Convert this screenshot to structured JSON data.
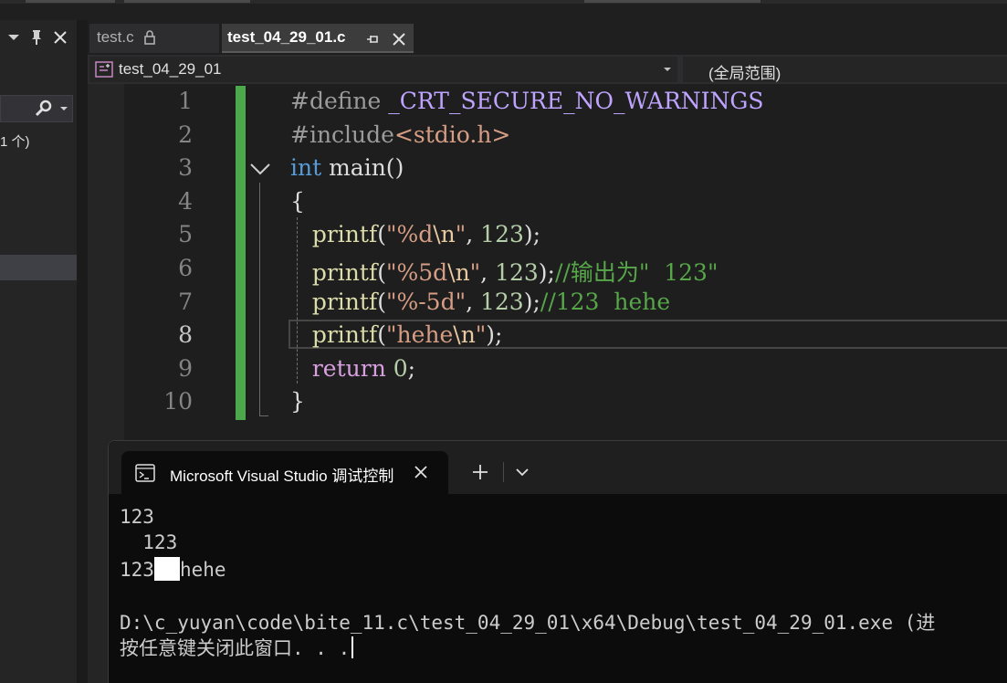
{
  "left_panel": {
    "search_icon": "search-icon",
    "count_text": "1 个)"
  },
  "tabs": [
    {
      "label": "test.c",
      "locked": true,
      "active": false
    },
    {
      "label": "test_04_29_01.c",
      "active": true
    }
  ],
  "nav": {
    "project": "test_04_29_01",
    "scope": "(全局范围)"
  },
  "editor": {
    "current_line": 8,
    "line_numbers": [
      "1",
      "2",
      "3",
      "4",
      "5",
      "6",
      "7",
      "8",
      "9",
      "10"
    ],
    "lines": [
      {
        "parts": [
          {
            "t": "#define ",
            "c": "pp"
          },
          {
            "t": "_CRT_SECURE_NO_WARNINGS",
            "c": "mac"
          }
        ]
      },
      {
        "parts": [
          {
            "t": "#include",
            "c": "pp"
          },
          {
            "t": "<stdio.h>",
            "c": "str"
          }
        ]
      },
      {
        "parts": [
          {
            "t": "int",
            "c": "kw"
          },
          {
            "t": " main()",
            "c": "plain"
          }
        ]
      },
      {
        "parts": [
          {
            "t": "{",
            "c": "plain"
          }
        ]
      },
      {
        "parts": [
          {
            "t": "   "
          },
          {
            "t": "printf",
            "c": "fn"
          },
          {
            "t": "(",
            "c": "plain"
          },
          {
            "t": "\"%d",
            "c": "str"
          },
          {
            "t": "\\n",
            "c": "esc"
          },
          {
            "t": "\"",
            "c": "str"
          },
          {
            "t": ", ",
            "c": "plain"
          },
          {
            "t": "123",
            "c": "num"
          },
          {
            "t": ");",
            "c": "plain"
          }
        ]
      },
      {
        "parts": [
          {
            "t": "   "
          },
          {
            "t": "printf",
            "c": "fn"
          },
          {
            "t": "(",
            "c": "plain"
          },
          {
            "t": "\"%5d",
            "c": "str"
          },
          {
            "t": "\\n",
            "c": "esc"
          },
          {
            "t": "\"",
            "c": "str"
          },
          {
            "t": ", ",
            "c": "plain"
          },
          {
            "t": "123",
            "c": "num"
          },
          {
            "t": ");",
            "c": "plain"
          },
          {
            "t": "//输出为\"  123\"",
            "c": "cmt"
          }
        ]
      },
      {
        "parts": [
          {
            "t": "   "
          },
          {
            "t": "printf",
            "c": "fn"
          },
          {
            "t": "(",
            "c": "plain"
          },
          {
            "t": "\"%-5d\"",
            "c": "str"
          },
          {
            "t": ", ",
            "c": "plain"
          },
          {
            "t": "123",
            "c": "num"
          },
          {
            "t": ");",
            "c": "plain"
          },
          {
            "t": "//123  hehe",
            "c": "cmt"
          }
        ]
      },
      {
        "parts": [
          {
            "t": "   "
          },
          {
            "t": "printf",
            "c": "fn"
          },
          {
            "t": "(",
            "c": "plain"
          },
          {
            "t": "\"hehe",
            "c": "str"
          },
          {
            "t": "\\n",
            "c": "esc"
          },
          {
            "t": "\"",
            "c": "str"
          },
          {
            "t": ");",
            "c": "plain"
          }
        ]
      },
      {
        "parts": [
          {
            "t": "   "
          },
          {
            "t": "return",
            "c": "ret"
          },
          {
            "t": " ",
            "c": "plain"
          },
          {
            "t": "0",
            "c": "num"
          },
          {
            "t": ";",
            "c": "plain"
          }
        ]
      },
      {
        "parts": [
          {
            "t": "}",
            "c": "plain"
          }
        ]
      }
    ]
  },
  "terminal": {
    "tab_title": "Microsoft Visual Studio 调试控制台",
    "output": [
      "123",
      "  123",
      "123",
      "hehe",
      "",
      "D:\\c_yuyan\\code\\bite_11.c\\test_04_29_01\\x64\\Debug\\test_04_29_01.exe (进",
      "按任意键关闭此窗口. . ."
    ]
  }
}
